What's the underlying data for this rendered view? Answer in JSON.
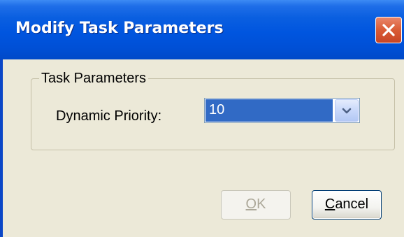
{
  "window": {
    "title": "Modify Task Parameters",
    "icons": {
      "close": "close-icon"
    },
    "colors": {
      "titlebar": "#0055df",
      "face": "#ece9d8",
      "close": "#d95b35",
      "selection": "#316ac5"
    }
  },
  "group": {
    "label": "Task Parameters",
    "priority_label": "Dynamic Priority:",
    "priority_value": "10",
    "dropdown_icon": "chevron-down-icon"
  },
  "buttons": {
    "ok": {
      "mnemonic": "O",
      "rest": "K",
      "enabled": false
    },
    "cancel": {
      "mnemonic": "C",
      "rest": "ancel",
      "enabled": true
    }
  }
}
